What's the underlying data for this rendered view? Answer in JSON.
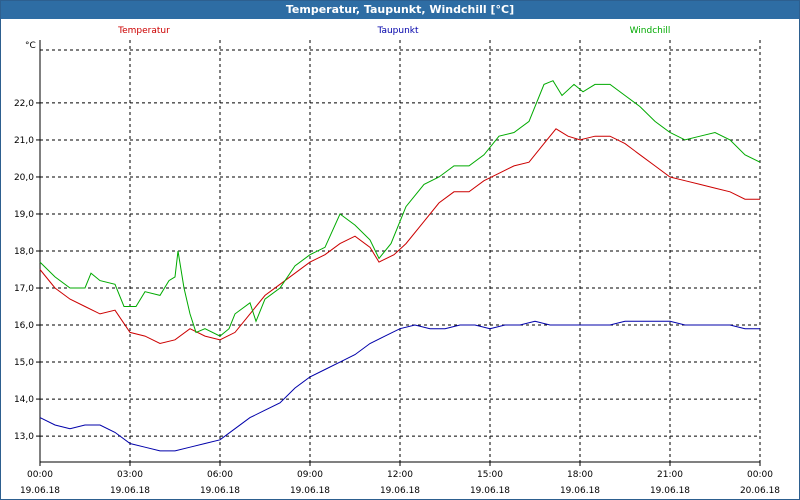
{
  "window": {
    "title": "Temperatur, Taupunkt, Windchill [°C]"
  },
  "chart_data": {
    "type": "line",
    "title": "Temperatur, Taupunkt, Windchill [°C]",
    "ylabel": "°C",
    "ylim": [
      12.3,
      23.7
    ],
    "grid": true,
    "x_ticks": [
      {
        "hours": 0,
        "time": "00:00",
        "date": "19.06.18"
      },
      {
        "hours": 3,
        "time": "03:00",
        "date": "19.06.18"
      },
      {
        "hours": 6,
        "time": "06:00",
        "date": "19.06.18"
      },
      {
        "hours": 9,
        "time": "09:00",
        "date": "19.06.18"
      },
      {
        "hours": 12,
        "time": "12:00",
        "date": "19.06.18"
      },
      {
        "hours": 15,
        "time": "15:00",
        "date": "19.06.18"
      },
      {
        "hours": 18,
        "time": "18:00",
        "date": "19.06.18"
      },
      {
        "hours": 21,
        "time": "21:00",
        "date": "19.06.18"
      },
      {
        "hours": 24,
        "time": "00:00",
        "date": "20.06.18"
      }
    ],
    "y_ticks": [
      "13,0",
      "14,0",
      "15,0",
      "16,0",
      "17,0",
      "18,0",
      "19,0",
      "20,0",
      "21,0",
      "22,0"
    ],
    "y_tick_values": [
      13,
      14,
      15,
      16,
      17,
      18,
      19,
      20,
      21,
      22
    ],
    "series": [
      {
        "name": "Temperatur",
        "color": "#cc0000",
        "points": [
          [
            0,
            17.5
          ],
          [
            0.5,
            17.0
          ],
          [
            1.0,
            16.7
          ],
          [
            1.5,
            16.5
          ],
          [
            2.0,
            16.3
          ],
          [
            2.5,
            16.4
          ],
          [
            3.0,
            15.8
          ],
          [
            3.5,
            15.7
          ],
          [
            4.0,
            15.5
          ],
          [
            4.5,
            15.6
          ],
          [
            5.0,
            15.9
          ],
          [
            5.5,
            15.7
          ],
          [
            6.0,
            15.6
          ],
          [
            6.5,
            15.8
          ],
          [
            7.0,
            16.3
          ],
          [
            7.5,
            16.8
          ],
          [
            8.0,
            17.1
          ],
          [
            8.5,
            17.4
          ],
          [
            9.0,
            17.7
          ],
          [
            9.5,
            17.9
          ],
          [
            10.0,
            18.2
          ],
          [
            10.5,
            18.4
          ],
          [
            11.0,
            18.1
          ],
          [
            11.3,
            17.7
          ],
          [
            11.8,
            17.9
          ],
          [
            12.2,
            18.2
          ],
          [
            12.8,
            18.8
          ],
          [
            13.3,
            19.3
          ],
          [
            13.8,
            19.6
          ],
          [
            14.3,
            19.6
          ],
          [
            14.8,
            19.9
          ],
          [
            15.3,
            20.1
          ],
          [
            15.8,
            20.3
          ],
          [
            16.3,
            20.4
          ],
          [
            16.8,
            20.9
          ],
          [
            17.2,
            21.3
          ],
          [
            17.6,
            21.1
          ],
          [
            18.0,
            21.0
          ],
          [
            18.5,
            21.1
          ],
          [
            19.0,
            21.1
          ],
          [
            19.5,
            20.9
          ],
          [
            20.0,
            20.6
          ],
          [
            20.5,
            20.3
          ],
          [
            21.0,
            20.0
          ],
          [
            21.5,
            19.9
          ],
          [
            22.0,
            19.8
          ],
          [
            22.5,
            19.7
          ],
          [
            23.0,
            19.6
          ],
          [
            23.5,
            19.4
          ],
          [
            24.0,
            19.4
          ]
        ]
      },
      {
        "name": "Taupunkt",
        "color": "#0000aa",
        "points": [
          [
            0,
            13.5
          ],
          [
            0.5,
            13.3
          ],
          [
            1.0,
            13.2
          ],
          [
            1.5,
            13.3
          ],
          [
            2.0,
            13.3
          ],
          [
            2.5,
            13.1
          ],
          [
            3.0,
            12.8
          ],
          [
            3.5,
            12.7
          ],
          [
            4.0,
            12.6
          ],
          [
            4.5,
            12.6
          ],
          [
            5.0,
            12.7
          ],
          [
            5.5,
            12.8
          ],
          [
            6.0,
            12.9
          ],
          [
            6.5,
            13.2
          ],
          [
            7.0,
            13.5
          ],
          [
            7.5,
            13.7
          ],
          [
            8.0,
            13.9
          ],
          [
            8.5,
            14.3
          ],
          [
            9.0,
            14.6
          ],
          [
            9.5,
            14.8
          ],
          [
            10.0,
            15.0
          ],
          [
            10.5,
            15.2
          ],
          [
            11.0,
            15.5
          ],
          [
            11.5,
            15.7
          ],
          [
            12.0,
            15.9
          ],
          [
            12.5,
            16.0
          ],
          [
            13.0,
            15.9
          ],
          [
            13.5,
            15.9
          ],
          [
            14.0,
            16.0
          ],
          [
            14.5,
            16.0
          ],
          [
            15.0,
            15.9
          ],
          [
            15.5,
            16.0
          ],
          [
            16.0,
            16.0
          ],
          [
            16.5,
            16.1
          ],
          [
            17.0,
            16.0
          ],
          [
            17.5,
            16.0
          ],
          [
            18.0,
            16.0
          ],
          [
            18.5,
            16.0
          ],
          [
            19.0,
            16.0
          ],
          [
            19.5,
            16.1
          ],
          [
            20.0,
            16.1
          ],
          [
            20.5,
            16.1
          ],
          [
            21.0,
            16.1
          ],
          [
            21.5,
            16.0
          ],
          [
            22.0,
            16.0
          ],
          [
            22.5,
            16.0
          ],
          [
            23.0,
            16.0
          ],
          [
            23.5,
            15.9
          ],
          [
            24.0,
            15.9
          ]
        ]
      },
      {
        "name": "Windchill",
        "color": "#00aa00",
        "points": [
          [
            0,
            17.7
          ],
          [
            0.5,
            17.3
          ],
          [
            1.0,
            17.0
          ],
          [
            1.5,
            17.0
          ],
          [
            1.7,
            17.4
          ],
          [
            2.0,
            17.2
          ],
          [
            2.5,
            17.1
          ],
          [
            2.8,
            16.5
          ],
          [
            3.2,
            16.5
          ],
          [
            3.5,
            16.9
          ],
          [
            4.0,
            16.8
          ],
          [
            4.3,
            17.2
          ],
          [
            4.5,
            17.3
          ],
          [
            4.6,
            18.0
          ],
          [
            4.8,
            17.0
          ],
          [
            5.0,
            16.3
          ],
          [
            5.2,
            15.8
          ],
          [
            5.5,
            15.9
          ],
          [
            6.0,
            15.7
          ],
          [
            6.3,
            15.9
          ],
          [
            6.5,
            16.3
          ],
          [
            7.0,
            16.6
          ],
          [
            7.2,
            16.1
          ],
          [
            7.5,
            16.7
          ],
          [
            8.0,
            17.0
          ],
          [
            8.5,
            17.6
          ],
          [
            9.0,
            17.9
          ],
          [
            9.5,
            18.1
          ],
          [
            10.0,
            19.0
          ],
          [
            10.5,
            18.7
          ],
          [
            11.0,
            18.3
          ],
          [
            11.3,
            17.8
          ],
          [
            11.7,
            18.2
          ],
          [
            12.2,
            19.2
          ],
          [
            12.8,
            19.8
          ],
          [
            13.3,
            20.0
          ],
          [
            13.8,
            20.3
          ],
          [
            14.3,
            20.3
          ],
          [
            14.8,
            20.6
          ],
          [
            15.3,
            21.1
          ],
          [
            15.8,
            21.2
          ],
          [
            16.3,
            21.5
          ],
          [
            16.8,
            22.5
          ],
          [
            17.1,
            22.6
          ],
          [
            17.4,
            22.2
          ],
          [
            17.8,
            22.5
          ],
          [
            18.1,
            22.3
          ],
          [
            18.5,
            22.5
          ],
          [
            19.0,
            22.5
          ],
          [
            19.5,
            22.2
          ],
          [
            20.0,
            21.9
          ],
          [
            20.5,
            21.5
          ],
          [
            21.0,
            21.2
          ],
          [
            21.5,
            21.0
          ],
          [
            22.0,
            21.1
          ],
          [
            22.5,
            21.2
          ],
          [
            23.0,
            21.0
          ],
          [
            23.5,
            20.6
          ],
          [
            24.0,
            20.4
          ]
        ]
      }
    ]
  }
}
